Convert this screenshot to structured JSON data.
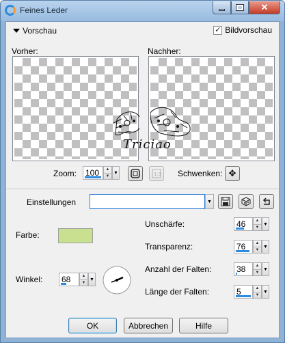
{
  "window": {
    "title": "Feines Leder"
  },
  "preview": {
    "section_label": "Vorschau",
    "checkbox_label": "Bildvorschau",
    "checkbox_checked": true,
    "before_label": "Vorher:",
    "after_label": "Nachher:",
    "watermark_text": "Triciao"
  },
  "zoom": {
    "label": "Zoom:",
    "value": "100",
    "pan_label": "Schwenken:"
  },
  "settings": {
    "label": "Einstellungen",
    "value": ""
  },
  "params": {
    "color_label": "Farbe:",
    "color_value": "#c8e08f",
    "angle_label": "Winkel:",
    "angle_value": "68",
    "blur_label": "Unschärfe:",
    "blur_value": "46",
    "transparency_label": "Transparenz:",
    "transparency_value": "76",
    "folds_label": "Anzahl der Falten:",
    "folds_value": "38",
    "fold_length_label": "Länge der Falten:",
    "fold_length_value": "5"
  },
  "buttons": {
    "ok": "OK",
    "cancel": "Abbrechen",
    "help": "Hilfe"
  }
}
